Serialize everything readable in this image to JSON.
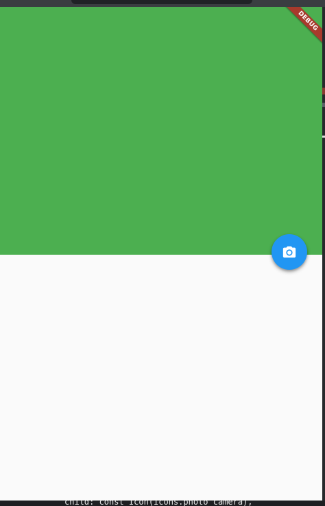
{
  "app": {
    "debug_banner": "DEBUG"
  },
  "fab": {
    "icon": "camera-icon",
    "color": "#2196f3"
  },
  "panel": {
    "color": "#4caf50"
  },
  "code_editor": {
    "visible_line": "child: const Icon(Icons.photo_camera),"
  }
}
